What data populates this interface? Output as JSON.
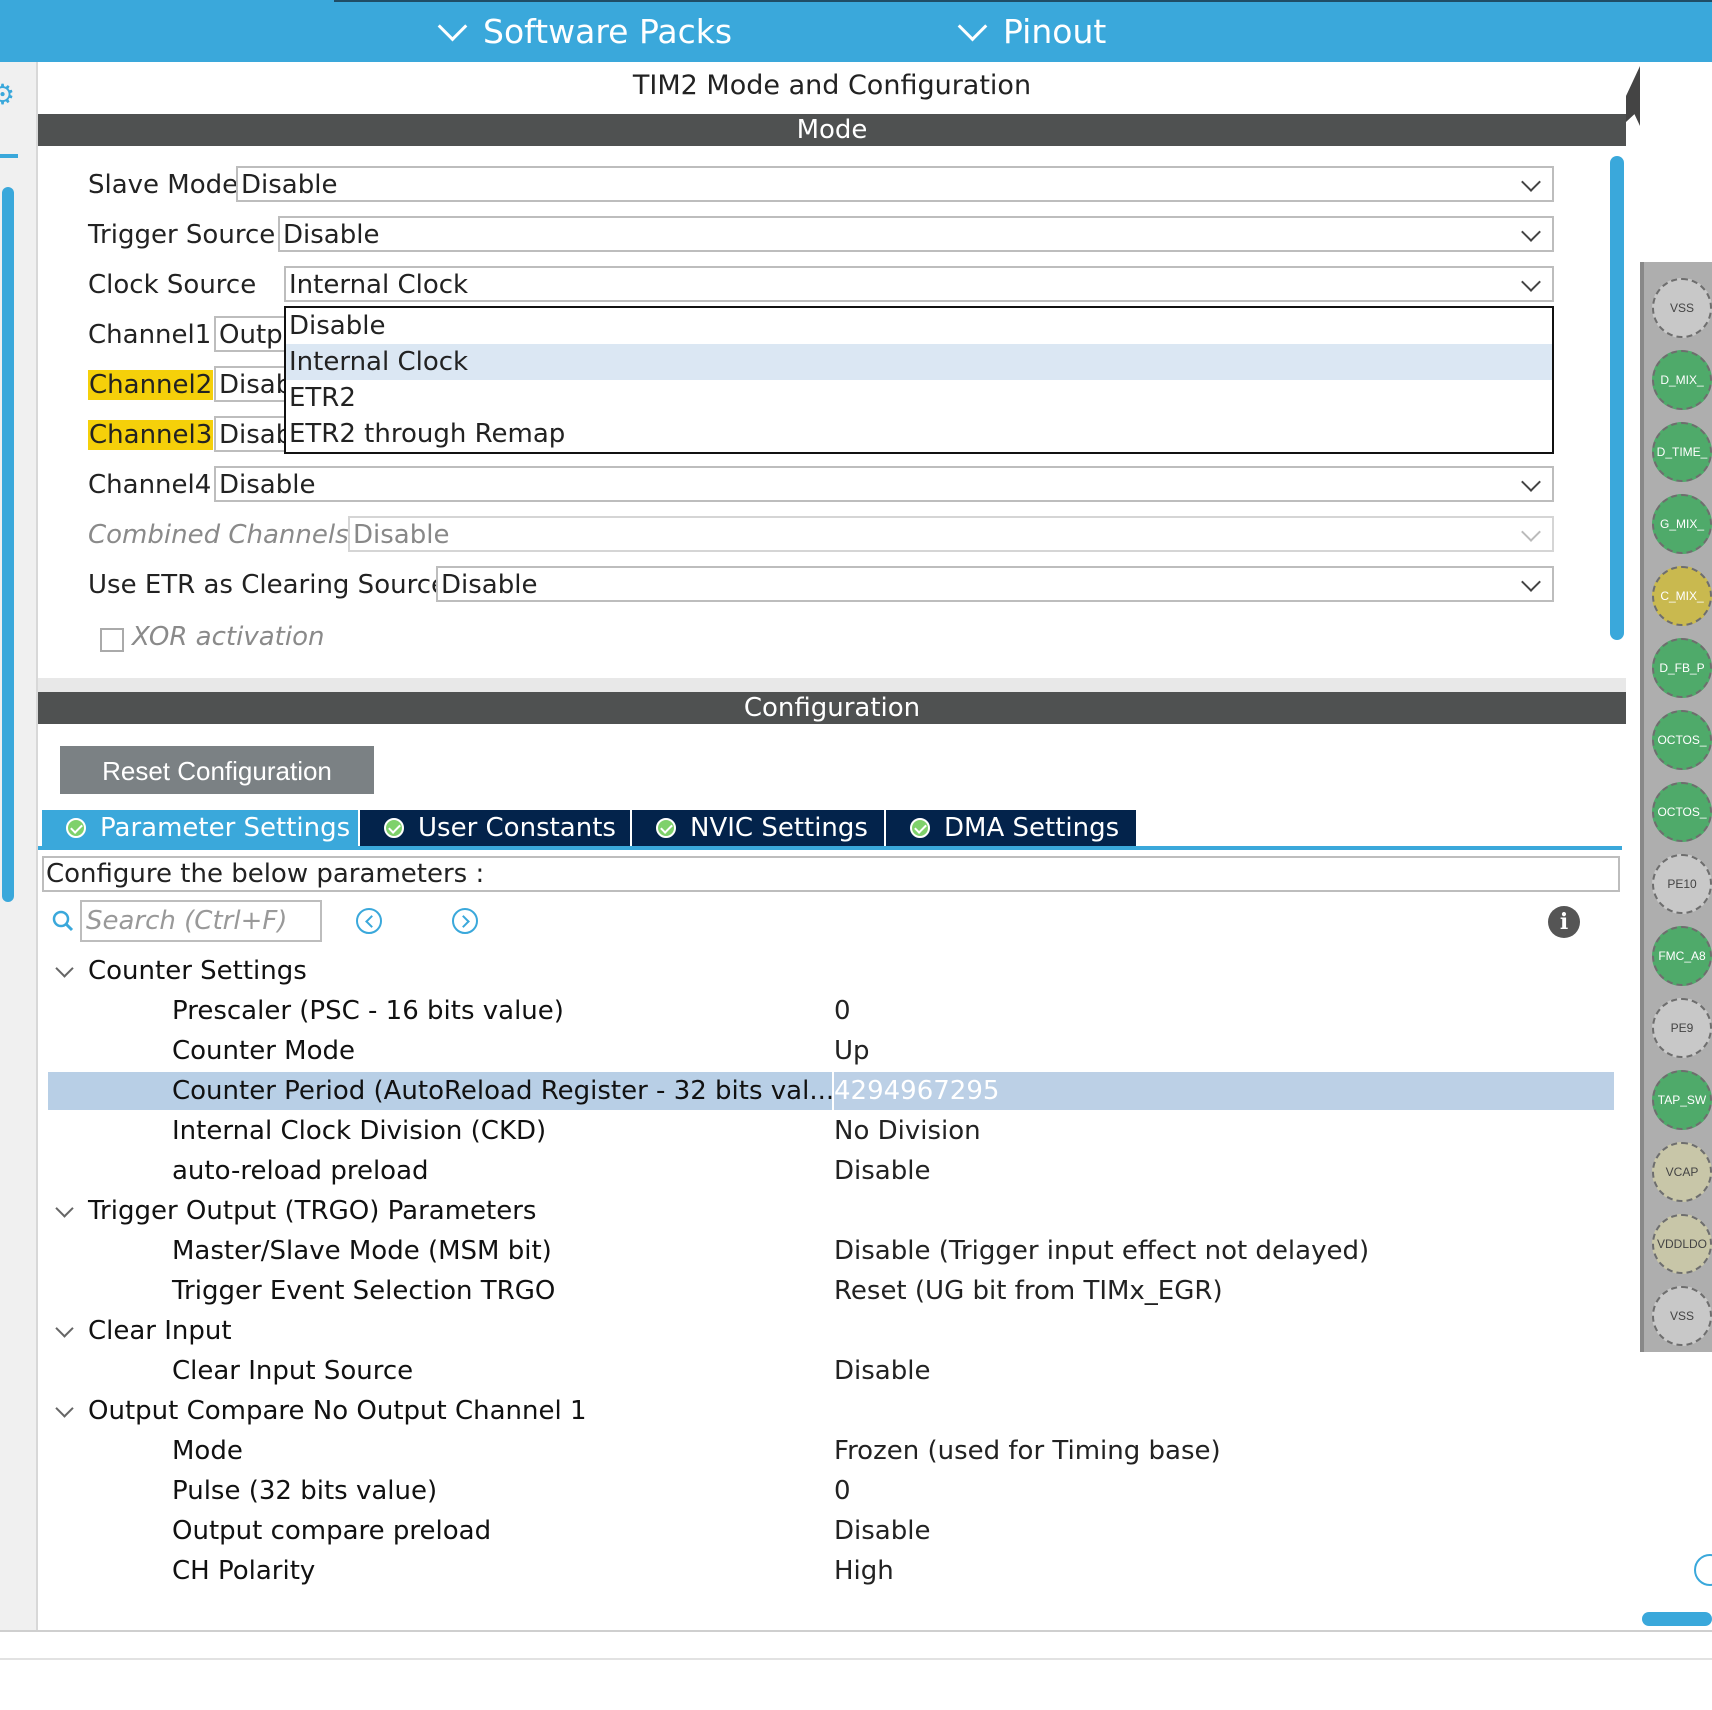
{
  "topbar": {
    "menus": [
      {
        "label": "Software Packs"
      },
      {
        "label": "Pinout"
      }
    ]
  },
  "panel_title": "TIM2 Mode and Configuration",
  "mode": {
    "header": "Mode",
    "rows": {
      "slave_mode": {
        "label": "Slave Mode",
        "value": "Disable"
      },
      "trigger_source": {
        "label": "Trigger Source",
        "value": "Disable"
      },
      "clock_source": {
        "label": "Clock Source",
        "value": "Internal Clock"
      },
      "channel1": {
        "label": "Channel1",
        "value": "Output Compare No Output"
      },
      "channel2": {
        "label": "Channel2",
        "value": "Disable"
      },
      "channel3": {
        "label": "Channel3",
        "value": "Disable"
      },
      "channel4": {
        "label": "Channel4",
        "value": "Disable"
      },
      "combined_channels": {
        "label": "Combined Channels",
        "value": "Disable"
      },
      "use_etr": {
        "label": "Use ETR as Clearing Source",
        "value": "Disable"
      }
    },
    "clock_source_options": [
      "Disable",
      "Internal Clock",
      "ETR2",
      "ETR2 through Remap"
    ],
    "xor_label": "XOR activation",
    "xor_checked": false
  },
  "configuration": {
    "header": "Configuration",
    "reset_button": "Reset Configuration",
    "tabs": [
      {
        "label": "Parameter Settings",
        "active": true
      },
      {
        "label": "User Constants",
        "active": false
      },
      {
        "label": "NVIC Settings",
        "active": false
      },
      {
        "label": "DMA Settings",
        "active": false
      }
    ],
    "description": "Configure the below parameters :",
    "search_placeholder": "Search (Ctrl+F)",
    "groups": [
      {
        "name": "Counter Settings",
        "params": [
          {
            "name": "Prescaler (PSC - 16 bits value)",
            "value": "0"
          },
          {
            "name": "Counter Mode",
            "value": "Up"
          },
          {
            "name": "Counter Period (AutoReload Register - 32 bits val...",
            "value": "4294967295"
          },
          {
            "name": "Internal Clock Division (CKD)",
            "value": "No Division"
          },
          {
            "name": "auto-reload preload",
            "value": "Disable"
          }
        ]
      },
      {
        "name": "Trigger Output (TRGO) Parameters",
        "params": [
          {
            "name": "Master/Slave Mode (MSM bit)",
            "value": "Disable (Trigger input effect not delayed)"
          },
          {
            "name": "Trigger Event Selection TRGO",
            "value": "Reset (UG bit from TIMx_EGR)"
          }
        ]
      },
      {
        "name": "Clear Input",
        "params": [
          {
            "name": "Clear Input Source",
            "value": "Disable"
          }
        ]
      },
      {
        "name": "Output Compare No Output Channel 1",
        "params": [
          {
            "name": "Mode",
            "value": "Frozen (used for Timing base)"
          },
          {
            "name": "Pulse (32 bits value)",
            "value": "0"
          },
          {
            "name": "Output compare preload",
            "value": "Disable"
          },
          {
            "name": "CH Polarity",
            "value": "High"
          }
        ]
      }
    ]
  },
  "pins": [
    {
      "label": "VSS",
      "color": "gray"
    },
    {
      "label": "D_MIX_",
      "color": "green"
    },
    {
      "label": "D_TIME_",
      "color": "green"
    },
    {
      "label": "G_MIX_",
      "color": "green"
    },
    {
      "label": "C_MIX_",
      "color": "olive"
    },
    {
      "label": "D_FB_P",
      "color": "green"
    },
    {
      "label": "OCTOS_",
      "color": "green"
    },
    {
      "label": "OCTOS_",
      "color": "green"
    },
    {
      "label": "PE10",
      "color": "gray"
    },
    {
      "label": "FMC_A8",
      "color": "green"
    },
    {
      "label": "PE9",
      "color": "gray"
    },
    {
      "label": "TAP_SW",
      "color": "green"
    },
    {
      "label": "VCAP",
      "color": "khaki"
    },
    {
      "label": "VDDLDO",
      "color": "khaki"
    },
    {
      "label": "VSS",
      "color": "gray"
    }
  ],
  "colors": {
    "accent": "#3aa8db",
    "header_bar": "#4f5151",
    "tab_inactive": "#03234b",
    "highlight": "#f5d00a",
    "selected_row": "#b8cfe6"
  }
}
